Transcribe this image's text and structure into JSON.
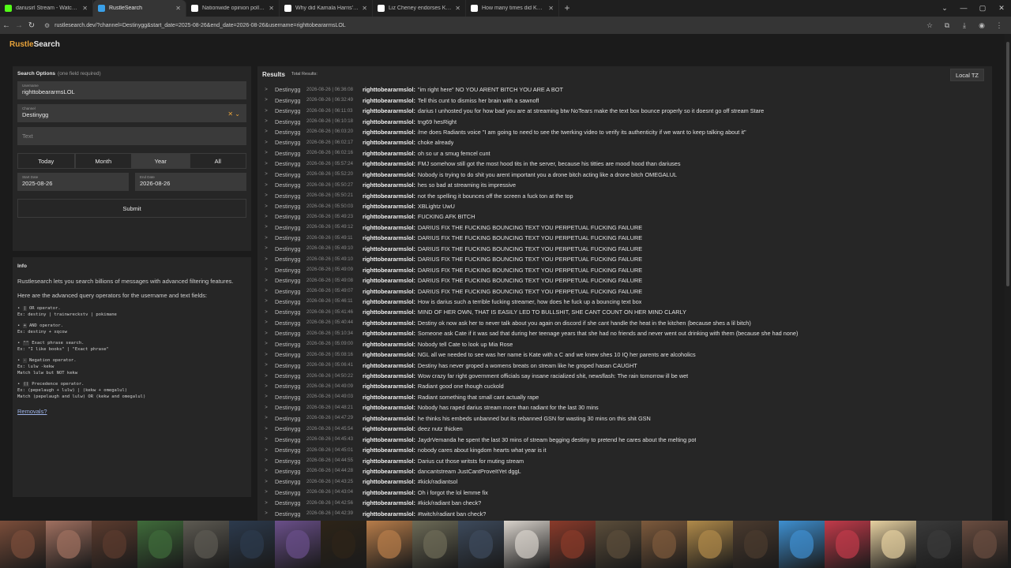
{
  "browser": {
    "tabs": [
      {
        "title": "dariusirl Stream - Watch Live on",
        "icon": "kick-icon",
        "color": "#53fc18",
        "active": false
      },
      {
        "title": "RustleSearch",
        "icon": "rustle-icon",
        "color": "#3aa0e8",
        "active": true
      },
      {
        "title": "Nationwide opinion polling for",
        "icon": "wikipedia-icon",
        "color": "#ffffff",
        "active": false
      },
      {
        "title": "Why did Kamala Harris's pollin",
        "icon": "chatgpt-icon",
        "color": "#ffffff",
        "active": false
      },
      {
        "title": "Liz Cheney endorses Kamala Ha",
        "icon": "chatgpt-icon",
        "color": "#ffffff",
        "active": false
      },
      {
        "title": "How many times did Kamala co",
        "icon": "chatgpt-icon",
        "color": "#ffffff",
        "active": false
      }
    ],
    "url": "rustlesearch.dev/?channel=Destinygg&start_date=2025-08-26&end_date=2026-08-26&username=righttobeararmsLOL"
  },
  "brand": {
    "part1": "Rustle",
    "part2": "Search"
  },
  "search": {
    "title": "Search Options",
    "subtitle": "(one field required)",
    "username_label": "Username",
    "username_value": "righttobeararmsLOL",
    "channel_label": "Channel",
    "channel_value": "Destinygg",
    "text_placeholder": "Text",
    "ranges": [
      "Today",
      "Month",
      "Year",
      "All"
    ],
    "selected_range": "Year",
    "start_label": "Start Date",
    "start_value": "2025-08-26",
    "end_label": "End Date",
    "end_value": "2026-08-26",
    "submit_label": "Submit"
  },
  "info": {
    "title": "Info",
    "para1": "Rustlesearch lets you search billions of messages with advanced filtering features.",
    "para2": "Here are the advanced query operators for the username and text fields:",
    "operators": [
      {
        "sym": "|",
        "desc": "OR operator.",
        "ex": "Ex: destiny | trainwreckstv | pokimane",
        "extra": ""
      },
      {
        "sym": "+",
        "desc": "AND operator.",
        "ex": "Ex: destiny + xqcow",
        "extra": ""
      },
      {
        "sym": "\"\"",
        "desc": "Exact phrase search.",
        "ex": "Ex: \"I like books\" | \"Exact phrase\"",
        "extra": ""
      },
      {
        "sym": "-",
        "desc": "Negation operator.",
        "ex": "Ex: lulw -kekw",
        "extra": "Match lulw but NOT kekw"
      },
      {
        "sym": "()",
        "desc": "Precedence operator.",
        "ex": "Ex: (pepelaugh + lulw) | (kekw + omegalul)",
        "extra": "Match (pepelaugh and lulw) OR (kekw and omegalul)"
      }
    ],
    "removals": "Removals?"
  },
  "results": {
    "title": "Results",
    "total_label": "Total Results:",
    "tz_button": "Local TZ",
    "channel": "Destinygg",
    "user": "righttobeararmslol:",
    "rows": [
      {
        "ts": "2026-08-26 | 06:36:08",
        "msg": "\"im right here\" NO YOU ARENT BITCH YOU ARE A BOT"
      },
      {
        "ts": "2026-08-26 | 06:32:49",
        "msg": "Tell this cunt to dismiss her brain with a sawnoff"
      },
      {
        "ts": "2026-08-26 | 06:11:03",
        "msg": "darius I unhosted you for how bad you are at streaming btw NoTears make the text box bounce properly so it doesnt go off stream Stare"
      },
      {
        "ts": "2026-08-26 | 06:10:18",
        "msg": "tng69 hesRight"
      },
      {
        "ts": "2026-08-26 | 06:03:20",
        "msg": "/me does Radiants voice \"I am going to need to see the twerking video to verify its authenticity if we want to keep talking about it\""
      },
      {
        "ts": "2026-08-26 | 06:02:17",
        "msg": "choke already"
      },
      {
        "ts": "2026-08-26 | 06:02:16",
        "msg": "oh so ur a smug femcel cunt"
      },
      {
        "ts": "2026-08-26 | 05:57:24",
        "msg": "FMJ somehow still got the most hood tits in the server, because his titties are mood hood than dariuses"
      },
      {
        "ts": "2026-08-26 | 05:52:20",
        "msg": "Nobody is trying to do shit you arent important you a drone bitch acting like a drone bitch OMEGALUL"
      },
      {
        "ts": "2026-08-26 | 05:50:27",
        "msg": "hes so bad at streaming its impressive"
      },
      {
        "ts": "2026-08-26 | 05:50:21",
        "msg": "not the spelling it bounces off the screen a fuck ton at the top"
      },
      {
        "ts": "2026-08-26 | 05:50:03",
        "msg": "XBLightz UwU"
      },
      {
        "ts": "2026-08-26 | 05:49:23",
        "msg": "FUCKING AFK BITCH"
      },
      {
        "ts": "2026-08-26 | 05:49:12",
        "msg": "DARIUS FIX THE FUCKING BOUNCING TEXT YOU PERPETUAL FUCKING FAILURE"
      },
      {
        "ts": "2026-08-26 | 05:49:11",
        "msg": "DARIUS FIX THE FUCKING BOUNCING TEXT YOU PERPETUAL FUCKING FAILURE"
      },
      {
        "ts": "2026-08-26 | 05:49:10",
        "msg": "DARIUS FIX THE FUCKING BOUNCING TEXT YOU PERPETUAL FUCKING FAILURE"
      },
      {
        "ts": "2026-08-26 | 05:49:10",
        "msg": "DARIUS FIX THE FUCKING BOUNCING TEXT YOU PERPETUAL FUCKING FAILURE"
      },
      {
        "ts": "2026-08-26 | 05:49:09",
        "msg": "DARIUS FIX THE FUCKING BOUNCING TEXT YOU PERPETUAL FUCKING FAILURE"
      },
      {
        "ts": "2026-08-26 | 05:49:08",
        "msg": "DARIUS FIX THE FUCKING BOUNCING TEXT YOU PERPETUAL FUCKING FAILURE"
      },
      {
        "ts": "2026-08-26 | 05:49:07",
        "msg": "DARIUS FIX THE FUCKING BOUNCING TEXT YOU PERPETUAL FUCKING FAILURE"
      },
      {
        "ts": "2026-08-26 | 05:46:11",
        "msg": "How is darius such a terrible fucking streamer, how does he fuck up a bouncing text box"
      },
      {
        "ts": "2026-08-26 | 05:41:46",
        "msg": "MIND OF HER OWN, THAT IS EASILY LED TO BULLSHIT, SHE CANT COUNT ON HER MIND CLARLY"
      },
      {
        "ts": "2026-08-26 | 05:40:44",
        "msg": "Destiny ok now ask her to never talk about you again on discord if she cant handle the heat in the kitchen (because shes a lil bitch)"
      },
      {
        "ts": "2026-08-26 | 05:10:34",
        "msg": "Someone ask Cate if it was sad that during her teenage years that she had no friends and never went out drinking with them (because she had none)"
      },
      {
        "ts": "2026-08-26 | 05:09:00",
        "msg": "Nobody tell Cate to look up Mia Rose"
      },
      {
        "ts": "2026-08-26 | 05:08:16",
        "msg": "NGL all we needed to see was her name is Kate with a C and we knew shes 10 IQ her parents are alcoholics"
      },
      {
        "ts": "2026-08-26 | 05:06:41",
        "msg": "Destiny has never groped a womens breats on stream like he groped hasan CAUGHT"
      },
      {
        "ts": "2026-08-26 | 04:50:22",
        "msg": "Wow crazy far right government officials say insane racialized shit, newsflash: The rain tomorrow ill be wet"
      },
      {
        "ts": "2026-08-26 | 04:49:09",
        "msg": "Radiant good one though cuckold"
      },
      {
        "ts": "2026-08-26 | 04:49:03",
        "msg": "Radiant something that small cant actually rape"
      },
      {
        "ts": "2026-08-26 | 04:48:21",
        "msg": "Nobody has raped darius stream more than radiant for the last 30 mins"
      },
      {
        "ts": "2026-08-26 | 04:47:29",
        "msg": "he thinks his embeds unbanned but its rebanned GSN for wasting 30 mins on this shit GSN"
      },
      {
        "ts": "2026-08-26 | 04:45:54",
        "msg": "deez nutz thicken"
      },
      {
        "ts": "2026-08-26 | 04:45:43",
        "msg": "JaydrVemanda he spent the last 30 mins of stream begging destiny to pretend he cares about the melting pot"
      },
      {
        "ts": "2026-08-26 | 04:45:01",
        "msg": "nobody cares about kingdom hearts what year is it"
      },
      {
        "ts": "2026-08-26 | 04:44:55",
        "msg": "Darius cut those writsts for muting stream"
      },
      {
        "ts": "2026-08-26 | 04:44:28",
        "msg": "dancantstream JustCantProveItYet dggL"
      },
      {
        "ts": "2026-08-26 | 04:43:25",
        "msg": "#kick/radiantsol"
      },
      {
        "ts": "2026-08-26 | 04:43:04",
        "msg": "Oh i forgot the lol lemme fix"
      },
      {
        "ts": "2026-08-26 | 04:42:56",
        "msg": "#kick/radiant ban check?"
      },
      {
        "ts": "2026-08-26 | 04:42:39",
        "msg": "#twitch/radiant ban check?"
      }
    ]
  },
  "strip": {
    "thumb_colors": [
      "#7a4d3a",
      "#a07060",
      "#5b3b2e",
      "#3f6b3a",
      "#5d5a52",
      "#2c3a4d",
      "#6a4f8a",
      "#2d2418",
      "#b87d4a",
      "#6d6b57",
      "#3d4a5c",
      "#d9d3cc",
      "#8a3a2a",
      "#5b4d3a",
      "#7d5a3c",
      "#b08a4a",
      "#4a3a2e",
      "#3e8fd0",
      "#c23a4a",
      "#e6d0a0",
      "#3a3a3a",
      "#6a4d40"
    ]
  }
}
